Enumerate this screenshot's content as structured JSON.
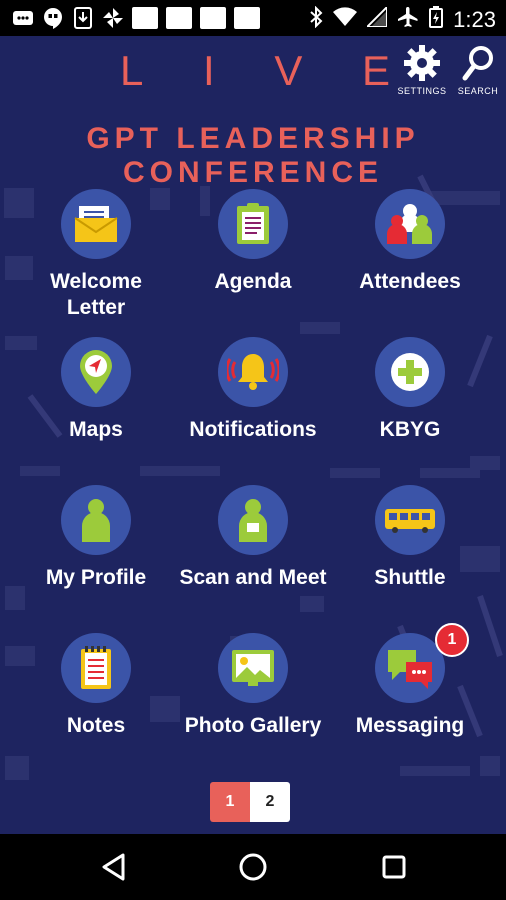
{
  "status_bar": {
    "time": "1:23",
    "left_icons": [
      "mail-icon",
      "hangouts-icon",
      "download-icon",
      "pinwheel-icon",
      "notification-square",
      "notification-square",
      "notification-square",
      "notification-square"
    ],
    "right_icons": [
      "bluetooth-icon",
      "wifi-icon",
      "signal-icon",
      "airplane-icon",
      "battery-icon"
    ]
  },
  "header": {
    "live_letters": [
      "L",
      "I",
      "V",
      "E"
    ],
    "settings_label": "SETTINGS",
    "search_label": "SEARCH",
    "conference_title": "GPT LEADERSHIP CONFERENCE"
  },
  "tiles": [
    {
      "label_lines": [
        "Welcome",
        "Letter"
      ],
      "icon": "envelope-icon"
    },
    {
      "label_lines": [
        "Agenda"
      ],
      "icon": "clipboard-icon"
    },
    {
      "label_lines": [
        "Attendees"
      ],
      "icon": "people-icon"
    },
    {
      "label_lines": [
        "Maps"
      ],
      "icon": "map-pin-icon"
    },
    {
      "label_lines": [
        "Notifications"
      ],
      "icon": "bell-icon"
    },
    {
      "label_lines": [
        "KBYG"
      ],
      "icon": "plus-icon"
    },
    {
      "label_lines": [
        "My Profile"
      ],
      "icon": "person-icon"
    },
    {
      "label_lines": [
        "Scan and Meet"
      ],
      "icon": "badge-person-icon"
    },
    {
      "label_lines": [
        "Shuttle"
      ],
      "icon": "bus-icon"
    },
    {
      "label_lines": [
        "Notes"
      ],
      "icon": "notepad-icon"
    },
    {
      "label_lines": [
        "Photo Gallery"
      ],
      "icon": "photo-icon"
    },
    {
      "label_lines": [
        "Messaging"
      ],
      "icon": "chat-icon",
      "badge": "1"
    }
  ],
  "pager": {
    "pages": [
      "1",
      "2"
    ],
    "active": "1"
  },
  "nav_bar": {
    "buttons": [
      "back-icon",
      "home-icon",
      "recents-icon"
    ]
  },
  "colors": {
    "background": "#1e2460",
    "accent": "#e8615a",
    "tile_circle": "#3b54a8",
    "badge": "#e52b34"
  }
}
